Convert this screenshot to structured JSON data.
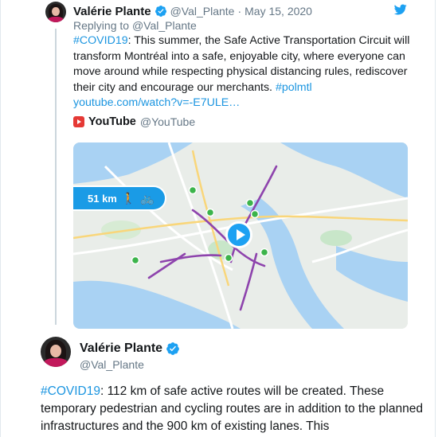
{
  "tweet1": {
    "author_name": "Valérie Plante",
    "author_handle": "@Val_Plante",
    "separator": "·",
    "date": "May 15, 2020",
    "replying_prefix": "Replying to",
    "replying_to": "@Val_Plante",
    "hashtag": "#COVID19",
    "body": ": This summer, the Safe Active Transportation Circuit will transform Montréal into a safe, enjoyable city, where everyone can move around while respecting physical distancing rules, rediscover their city and encourage our merchants. ",
    "hashtag2": "#polmtl",
    "link": "youtube.com/watch?v=-E7ULE…",
    "card": {
      "source_name": "YouTube",
      "source_handle": "@YouTube",
      "badge_text": "51 km",
      "walk_icon": "walk-icon",
      "bike_icon": "bike-icon"
    }
  },
  "tweet2": {
    "author_name": "Valérie Plante",
    "author_handle": "@Val_Plante",
    "hashtag": "#COVID19",
    "body": ": 112 km of safe active routes will be created. These temporary pedestrian and cycling routes are in addition to the planned infrastructures and the 900 km of existing lanes. This"
  },
  "colors": {
    "link": "#1b95e0",
    "verified": "#1da1f2",
    "muted": "#657786",
    "route": "#8e44ad",
    "marker": "#3cb44b"
  }
}
